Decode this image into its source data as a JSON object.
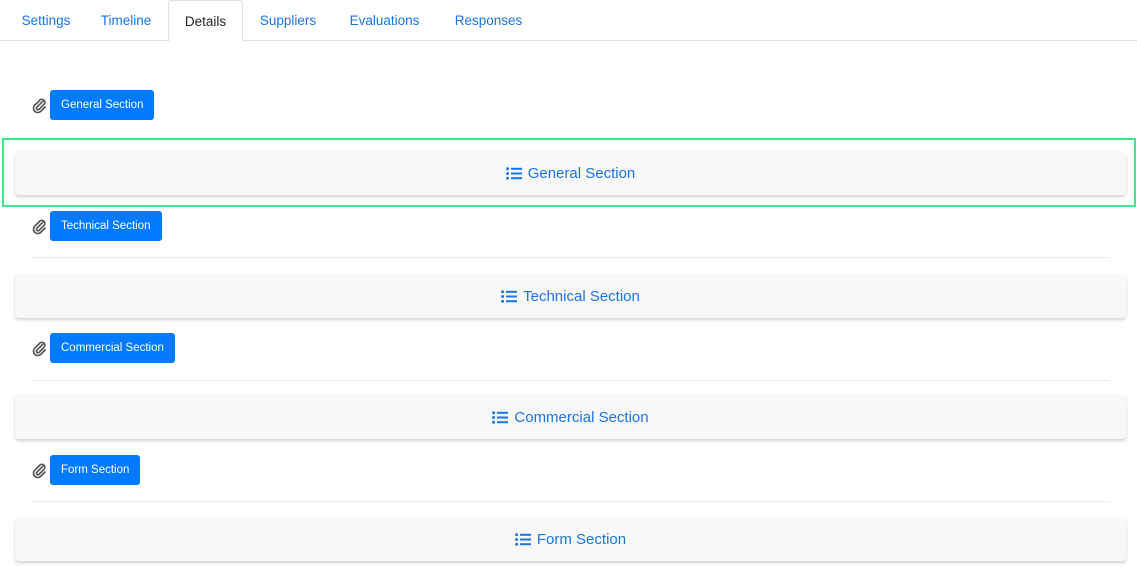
{
  "tabs": [
    {
      "label": "Settings"
    },
    {
      "label": "Timeline"
    },
    {
      "label": "Details",
      "active": true
    },
    {
      "label": "Suppliers"
    },
    {
      "label": "Evaluations"
    },
    {
      "label": "Responses"
    }
  ],
  "sections": [
    {
      "attach_label": "General Section",
      "bar_label": "General Section",
      "highlighted": true
    },
    {
      "attach_label": "Technical Section",
      "bar_label": "Technical Section"
    },
    {
      "attach_label": "Commercial Section",
      "bar_label": "Commercial Section"
    },
    {
      "attach_label": "Form Section",
      "bar_label": "Form Section"
    }
  ],
  "icons": {
    "attachment": "paperclip-icon",
    "section": "list-icon"
  },
  "colors": {
    "link_blue": "#1b74e4",
    "button_blue": "#007bff",
    "highlight_green": "#3ee68c",
    "bar_background": "#f8f8f8"
  }
}
